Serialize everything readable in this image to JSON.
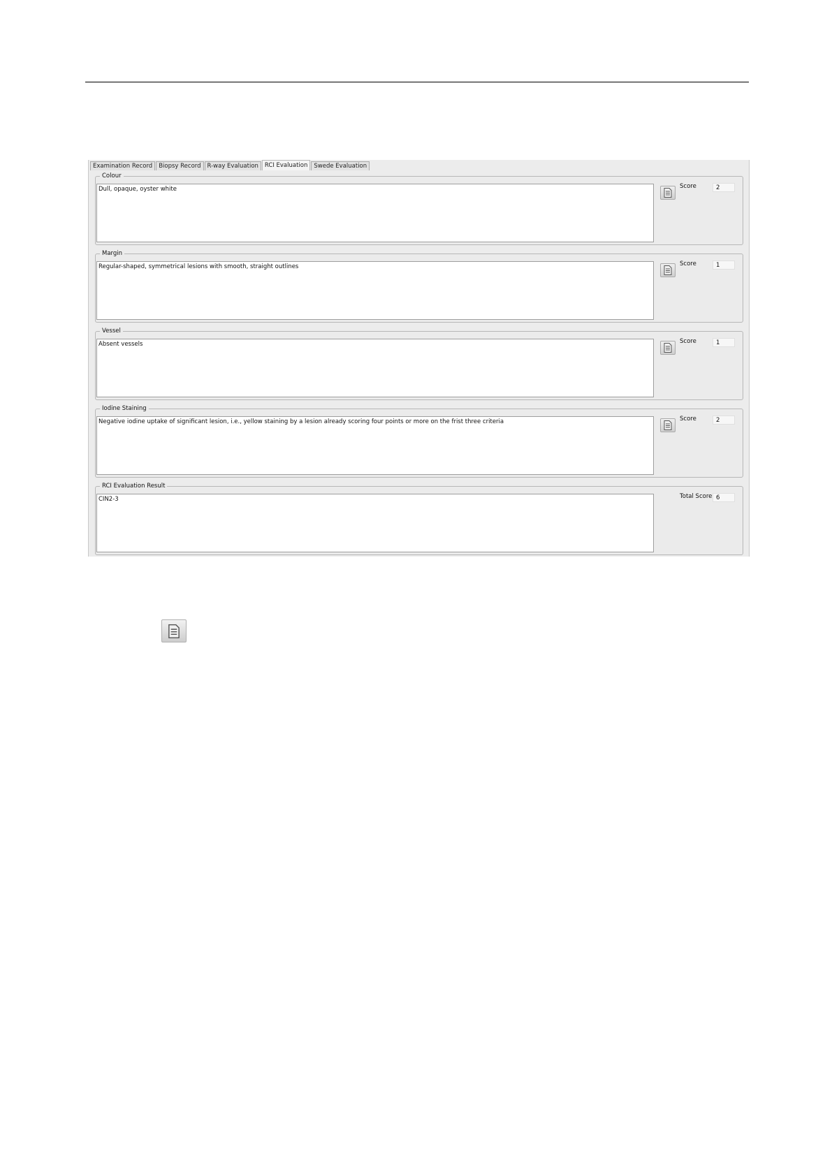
{
  "tabs": [
    {
      "label": "Examination Record",
      "active": false
    },
    {
      "label": "Biopsy Record",
      "active": false
    },
    {
      "label": "R-way Evaluation",
      "active": false
    },
    {
      "label": "RCI Evaluation",
      "active": true
    },
    {
      "label": "Swede Evaluation",
      "active": false
    }
  ],
  "sections": {
    "colour": {
      "title": "Colour",
      "text": "Dull, opaque, oyster white",
      "score_label": "Score",
      "score": "2",
      "icon": "document-icon"
    },
    "margin": {
      "title": "Margin",
      "text": "Regular-shaped, symmetrical lesions with smooth, straight outlines",
      "score_label": "Score",
      "score": "1",
      "icon": "document-icon"
    },
    "vessel": {
      "title": "Vessel",
      "text": "Absent vessels",
      "score_label": "Score",
      "score": "1",
      "icon": "document-icon"
    },
    "iodine": {
      "title": "Iodine Staining",
      "text": "Negative iodine uptake of significant lesion, i.e., yellow staining by a lesion already scoring four points or more on the frist three criteria",
      "score_label": "Score",
      "score": "2",
      "icon": "document-icon"
    }
  },
  "result": {
    "title": "RCI Evaluation Result",
    "text": "CIN2-3",
    "total_label": "Total Score",
    "total": "6"
  },
  "legend_icon": "document-icon"
}
